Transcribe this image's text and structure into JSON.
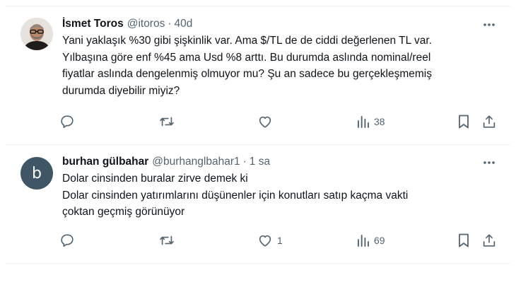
{
  "tweets": [
    {
      "author_name": "İsmet Toros",
      "handle": "@itoros",
      "separator": "·",
      "time": "40d",
      "avatar_type": "photo",
      "text_lines": [
        "Yani yaklaşık %30 gibi şişkinlik var. Ama $/TL de de ciddi değerlenen TL var.",
        "Yılbaşına göre enf %45 ama Usd %8 arttı. Bu durumda aslında nominal/reel",
        "fiyatlar aslında dengelenmiş olmuyor mu? Şu an sadece bu gerçekleşmemiş",
        "durumda diyebilir miyiz?"
      ],
      "likes": "",
      "views": "38"
    },
    {
      "author_name": "burhan gülbahar",
      "handle": "@burhanglbahar1",
      "separator": "·",
      "time": "1 sa",
      "avatar_type": "letter",
      "avatar_letter": "b",
      "text_lines": [
        "Dolar cinsinden buralar zirve demek ki",
        "Dolar cinsinden yatırımlarını düşünenler için konutları satıp kaçma vakti",
        "çoktan geçmiş görünüyor"
      ],
      "likes": "1",
      "views": "69"
    }
  ],
  "icons": {
    "more": "more-horizontal-icon",
    "reply": "reply-icon",
    "retweet": "retweet-icon",
    "like": "heart-icon",
    "views": "views-icon",
    "bookmark": "bookmark-icon",
    "share": "share-icon"
  },
  "colors": {
    "text": "#0f1419",
    "secondary": "#536471",
    "divider": "#eff3f4",
    "avatar_letter_bg": "#3f5666"
  }
}
